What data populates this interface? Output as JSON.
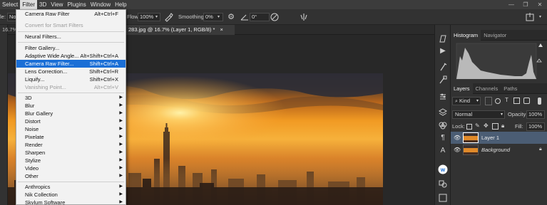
{
  "menubar": {
    "items": [
      "Select",
      "Filter",
      "3D",
      "View",
      "Plugins",
      "Window",
      "Help"
    ],
    "active": "Filter"
  },
  "options_bar": {
    "left_label": "le:",
    "mode_value": "Nor",
    "flow_label": "Flow:",
    "flow_value": "100%",
    "smoothing_label": "Smoothing:",
    "smoothing_value": "0%",
    "angle_value": "0°"
  },
  "doc_tabs": {
    "left_tab": "16.7% (L",
    "active_tab": "283.jpg @ 16.7% (Layer 1, RGB/8) *",
    "close_glyph": "×"
  },
  "filter_menu": {
    "groups": [
      [
        {
          "label": "Camera Raw Filter",
          "shortcut": "Alt+Ctrl+F",
          "state": "normal"
        },
        {
          "label": "Convert for Smart Filters",
          "shortcut": "",
          "state": "disabled"
        }
      ],
      [
        {
          "label": "Neural Filters...",
          "shortcut": "",
          "state": "normal"
        }
      ],
      [
        {
          "label": "Filter Gallery...",
          "shortcut": "",
          "state": "normal"
        },
        {
          "label": "Adaptive Wide Angle...",
          "shortcut": "Alt+Shift+Ctrl+A",
          "state": "normal"
        },
        {
          "label": "Camera Raw Filter...",
          "shortcut": "Shift+Ctrl+A",
          "state": "highlighted"
        },
        {
          "label": "Lens Correction...",
          "shortcut": "Shift+Ctrl+R",
          "state": "normal"
        },
        {
          "label": "Liquify...",
          "shortcut": "Shift+Ctrl+X",
          "state": "normal"
        },
        {
          "label": "Vanishing Point...",
          "shortcut": "Alt+Ctrl+V",
          "state": "disabled"
        }
      ],
      [
        {
          "label": "3D",
          "submenu": true
        },
        {
          "label": "Blur",
          "submenu": true
        },
        {
          "label": "Blur Gallery",
          "submenu": true
        },
        {
          "label": "Distort",
          "submenu": true
        },
        {
          "label": "Noise",
          "submenu": true
        },
        {
          "label": "Pixelate",
          "submenu": true
        },
        {
          "label": "Render",
          "submenu": true
        },
        {
          "label": "Sharpen",
          "submenu": true
        },
        {
          "label": "Stylize",
          "submenu": true
        },
        {
          "label": "Video",
          "submenu": true
        },
        {
          "label": "Other",
          "submenu": true
        }
      ],
      [
        {
          "label": "Anthropics",
          "submenu": true
        },
        {
          "label": "Nik Collection",
          "submenu": true
        },
        {
          "label": "Skylum Software",
          "submenu": true
        }
      ]
    ]
  },
  "histogram_panel": {
    "tabs": [
      "Histogram",
      "Navigator"
    ],
    "active": "Histogram"
  },
  "layers_panel": {
    "tabs": [
      "Layers",
      "Channels",
      "Paths"
    ],
    "active": "Layers",
    "filter_kind": "Kind",
    "blend_mode": "Normal",
    "opacity_label": "Opacity:",
    "opacity_value": "100%",
    "lock_label": "Lock:",
    "fill_label": "Fill:",
    "fill_value": "100%",
    "layers": [
      {
        "name": "Layer 1",
        "selected": true,
        "italic": false
      },
      {
        "name": "Background",
        "selected": false,
        "italic": true
      }
    ]
  },
  "colors": {
    "menu_highlight": "#1a6fd6",
    "panel_bg": "#323232",
    "layer_selected": "#4b5d74"
  }
}
